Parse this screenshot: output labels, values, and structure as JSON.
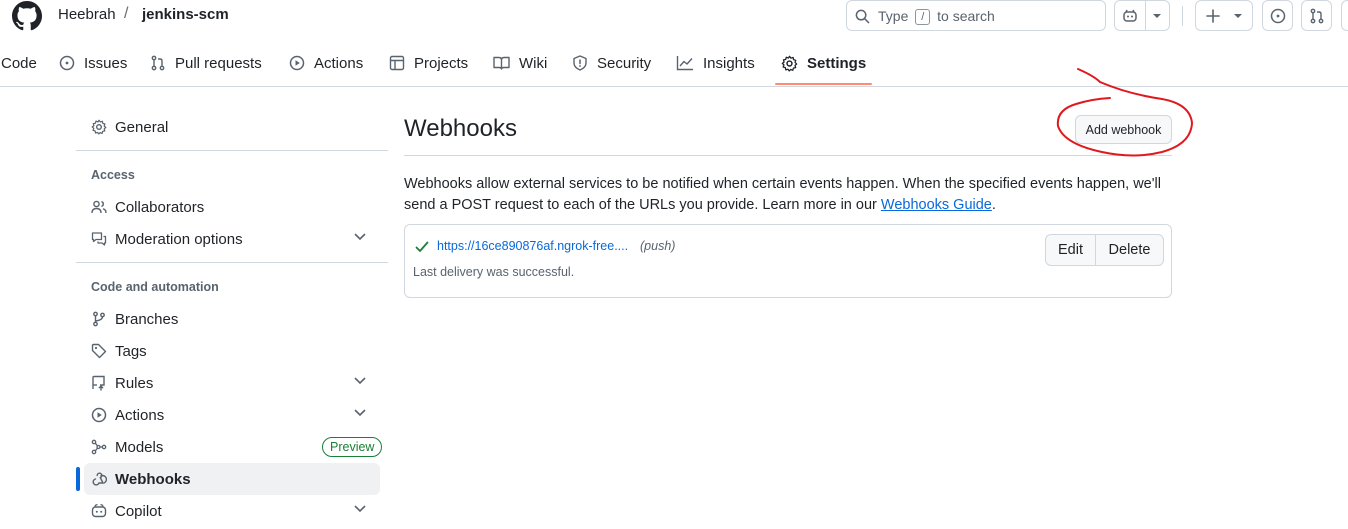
{
  "header": {
    "owner": "Heebrah",
    "separator": "/",
    "repo": "jenkins-scm",
    "search_prefix": "Type",
    "search_key": "/",
    "search_suffix": "to search"
  },
  "tabs": [
    {
      "label": "Code",
      "icon": "code-icon"
    },
    {
      "label": "Issues",
      "icon": "issue-icon"
    },
    {
      "label": "Pull requests",
      "icon": "pull-request-icon"
    },
    {
      "label": "Actions",
      "icon": "play-icon"
    },
    {
      "label": "Projects",
      "icon": "table-icon"
    },
    {
      "label": "Wiki",
      "icon": "book-icon"
    },
    {
      "label": "Security",
      "icon": "shield-icon"
    },
    {
      "label": "Insights",
      "icon": "graph-icon"
    },
    {
      "label": "Settings",
      "icon": "gear-icon",
      "active": true
    }
  ],
  "sidebar": {
    "general": "General",
    "access_heading": "Access",
    "collaborators": "Collaborators",
    "moderation": "Moderation options",
    "automation_heading": "Code and automation",
    "branches": "Branches",
    "tags": "Tags",
    "rules": "Rules",
    "actions": "Actions",
    "models": "Models",
    "models_badge": "Preview",
    "webhooks": "Webhooks",
    "copilot": "Copilot"
  },
  "main": {
    "title": "Webhooks",
    "add_button": "Add webhook",
    "description": "Webhooks allow external services to be notified when certain events happen. When the specified events happen, we'll send a POST request to each of the URLs you provide. Learn more in our",
    "guide_link": "Webhooks Guide",
    "period": "."
  },
  "webhook": {
    "url": "https://16ce890876af.ngrok-free....",
    "event": "(push)",
    "status": "Last delivery was successful.",
    "edit": "Edit",
    "delete": "Delete"
  },
  "colors": {
    "accent": "#0969da",
    "tab_underline": "#fd8c73",
    "success": "#1a7f37",
    "annotation": "#e0191f"
  }
}
